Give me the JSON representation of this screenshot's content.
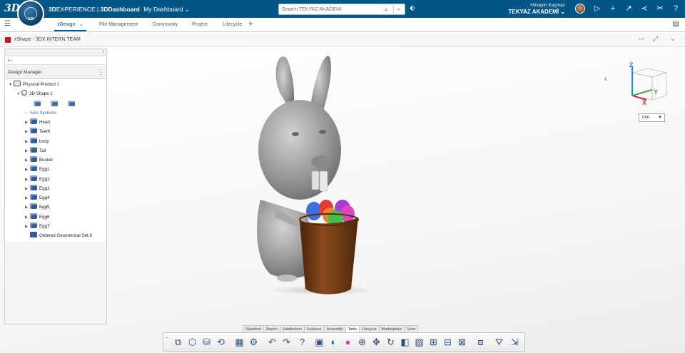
{
  "topbar": {
    "logo": "3DS",
    "compass_version": "V.R",
    "brand_prefix": "3D",
    "brand_name": "EXPERIENCE",
    "brand_separator": " | ",
    "dashboard_label": "3DDashboard",
    "dashboard_name": "My Dashboard",
    "dashboard_caret": "⌄",
    "search_placeholder": "Search TEKYAZ AKADEMİ",
    "user_name": "Hüseyin Kaçmaz",
    "organization": "TEKYAZ AKADEMİ",
    "icons": [
      "play-icon",
      "add-icon",
      "share-icon",
      "network-icon",
      "tools-icon",
      "help-icon"
    ]
  },
  "tabs": {
    "items": [
      "xDesign",
      "File Management",
      "Community",
      "Project",
      "Lifecycle"
    ],
    "active_caret": "⌄"
  },
  "app": {
    "title": "xShape - 3DX INTERN TEAM"
  },
  "design_manager": {
    "title": "Design Manager",
    "root": "Physical Product 1",
    "shape": "3D Shape 1",
    "axis_systems": "Axis Systems",
    "parts": [
      "Head",
      "Teeth",
      "body",
      "Tail",
      "Bucket",
      "Egg1",
      "Egg2",
      "Egg3",
      "Egg4",
      "Egg5",
      "Egg6",
      "Egg7"
    ],
    "geo_set": "Ordered Geometrical Set.8"
  },
  "viewport": {
    "units": "mm",
    "axis_labels": {
      "x": "X",
      "y": "Y",
      "z": "Z"
    },
    "colors": {
      "bunny": "#9a9a9a",
      "bucket": "#6b3714",
      "axis_x": "#d32f2f",
      "axis_y": "#43a047",
      "axis_z": "#1e88e5"
    }
  },
  "action_bar": {
    "tabs": [
      "Standard",
      "Sketch",
      "Subdivision",
      "Features",
      "Assembly",
      "Tools",
      "Lifecycle",
      "Marketplace",
      "View"
    ],
    "active_tab": "Tools"
  },
  "colors": {
    "brand": "#005686",
    "accent": "#2a6fb8"
  }
}
